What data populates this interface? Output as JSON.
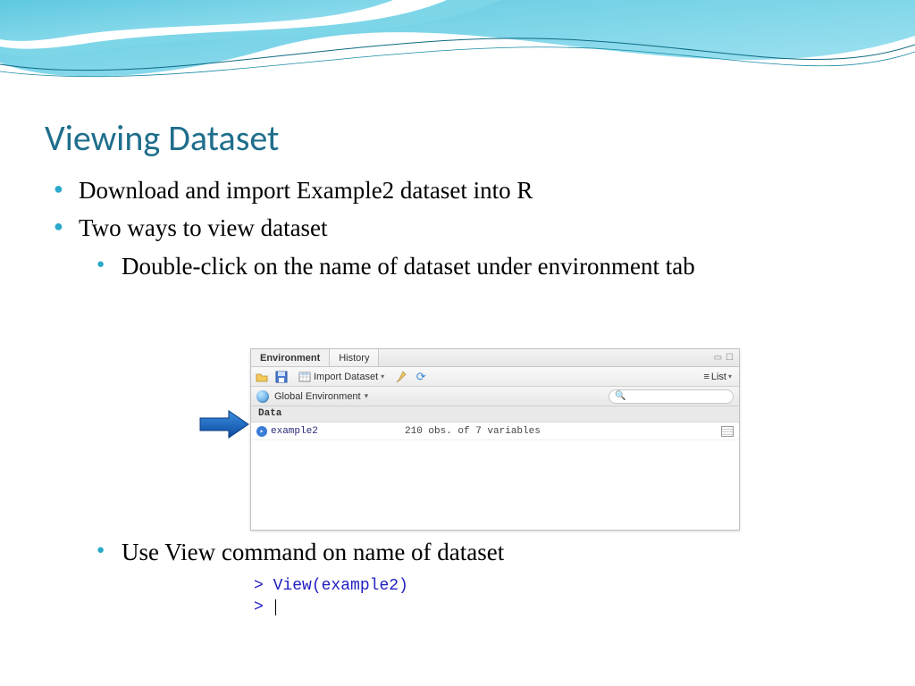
{
  "title": "Viewing Dataset",
  "bullets": {
    "b1": "Download and import Example2 dataset into R",
    "b2": "Two ways to view dataset",
    "sub1": "Double-click on the name of dataset under environment tab",
    "sub2": "Use View command on name of dataset"
  },
  "env_panel": {
    "tabs": {
      "environment": "Environment",
      "history": "History"
    },
    "toolbar": {
      "import": "Import Dataset",
      "list": "List"
    },
    "scope": "Global Environment",
    "section": "Data",
    "row": {
      "name": "example2",
      "desc": "210 obs. of 7 variables"
    }
  },
  "console": {
    "line1_prompt": ">",
    "line1_cmd": "View(example2)",
    "line2_prompt": ">"
  }
}
